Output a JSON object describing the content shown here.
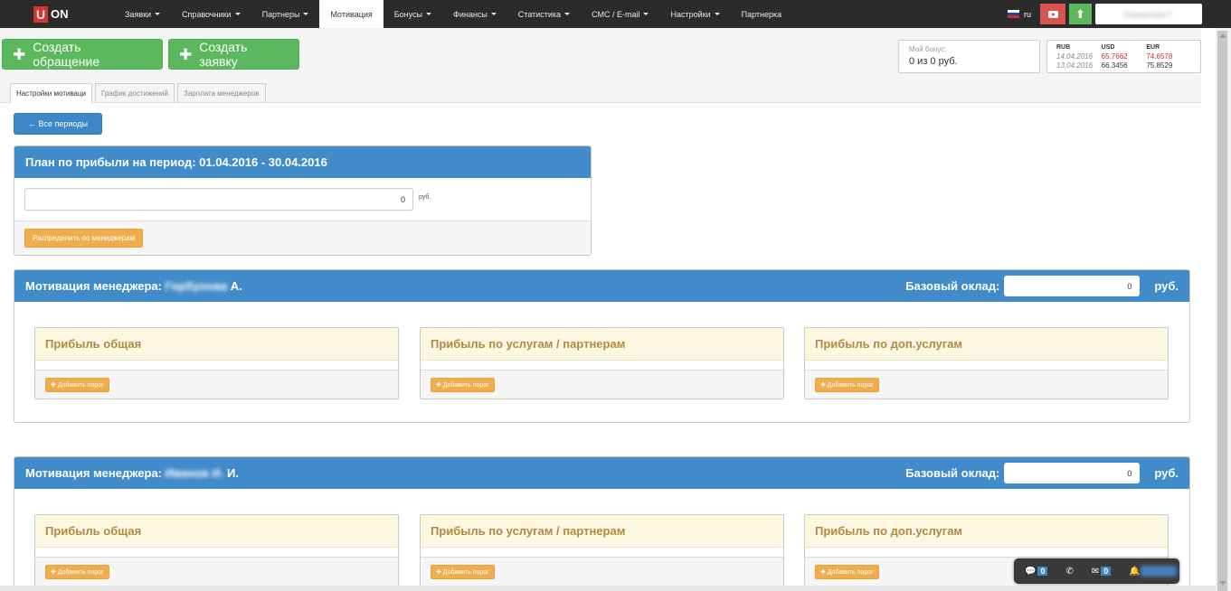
{
  "logo": {
    "u": "U",
    "on": "ON"
  },
  "nav": {
    "items": [
      {
        "label": "Заявки",
        "dropdown": true
      },
      {
        "label": "Справочники",
        "dropdown": true
      },
      {
        "label": "Партнеры",
        "dropdown": true
      },
      {
        "label": "Мотивация",
        "dropdown": false,
        "active": true
      },
      {
        "label": "Бонусы",
        "dropdown": true
      },
      {
        "label": "Финансы",
        "dropdown": true
      },
      {
        "label": "Статистика",
        "dropdown": true
      },
      {
        "label": "СМС / E-mail",
        "dropdown": true
      },
      {
        "label": "Настройки",
        "dropdown": true
      },
      {
        "label": "Партнерка",
        "dropdown": false
      }
    ],
    "lang": "ru",
    "user": "Корнилова Г.",
    "up_arrow": "⬆"
  },
  "actions": {
    "create_request": "Создать обращение",
    "create_order": "Создать заявку"
  },
  "bonus": {
    "label": "Мой бонус:",
    "value": "0 из 0 руб."
  },
  "rates": {
    "headers": [
      "RUB",
      "USD",
      "EUR"
    ],
    "rows": [
      {
        "date": "14.04.2016",
        "usd": "65.7662",
        "eur": "74.6578"
      },
      {
        "date": "13.04.2016",
        "usd": "66.3456",
        "eur": "75.8529"
      }
    ]
  },
  "tabs": [
    "Настройки мотиваци",
    "График достижений",
    "Зарплата менеджеров"
  ],
  "back_button": "← Все периоды",
  "plan": {
    "title": "План по прибыли на период: 01.04.2016 - 30.04.2016",
    "value": "0",
    "unit": "руб.",
    "distribute_button": "Распределить по менеджерам"
  },
  "managers": [
    {
      "title": "Мотивация менеджера:",
      "name": "Горбунова",
      "initial": "А.",
      "base_label": "Базовый оклад:",
      "base_value": "0",
      "base_unit": "руб."
    },
    {
      "title": "Мотивация менеджера:",
      "name": "Иванов И.",
      "initial": "И.",
      "base_label": "Базовый оклад:",
      "base_value": "0",
      "base_unit": "руб."
    }
  ],
  "cards": [
    {
      "title": "Прибыль общая",
      "button": "✚ Добавить порог"
    },
    {
      "title": "Прибыль по услугам / партнерам",
      "button": "✚ Добавить порог"
    },
    {
      "title": "Прибыль по доп.услугам",
      "button": "✚ Добавить порог"
    }
  ],
  "chat": {
    "messages": "0",
    "mail": "0"
  }
}
